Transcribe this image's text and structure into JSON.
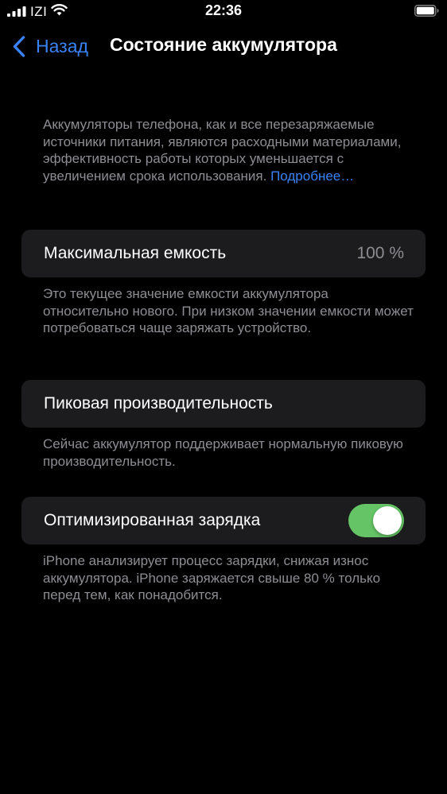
{
  "status_bar": {
    "carrier": "IZI",
    "time": "22:36",
    "icons": [
      "signal-icon",
      "wifi-icon",
      "battery-icon"
    ]
  },
  "nav": {
    "back_label": "Назад",
    "title": "Состояние аккумулятора"
  },
  "intro": {
    "text": "Аккумуляторы телефона, как и все перезаряжаемые источники питания, являются расходными материалами, эффективность работы которых уменьшается с увеличением срока использования.",
    "link": "Подробнее…"
  },
  "max_capacity": {
    "label": "Максимальная емкость",
    "value": "100 %",
    "footer": "Это текущее значение емкости аккумулятора относительно нового. При низком значении емкости может потребоваться чаще заряжать устройство."
  },
  "peak_performance": {
    "label": "Пиковая производительность",
    "footer": "Сейчас аккумулятор поддерживает нормальную пиковую производительность."
  },
  "optimized_charging": {
    "label": "Оптимизированная зарядка",
    "enabled": true,
    "footer": "iPhone анализирует процесс зарядки, снижая износ аккумулятора. iPhone заряжается свыше 80 % только перед тем, как понадобится."
  },
  "colors": {
    "accent": "#3a82f7",
    "toggle_on": "#65c466",
    "cell_background": "#1c1c1e",
    "secondary_text": "#8d8d93"
  }
}
